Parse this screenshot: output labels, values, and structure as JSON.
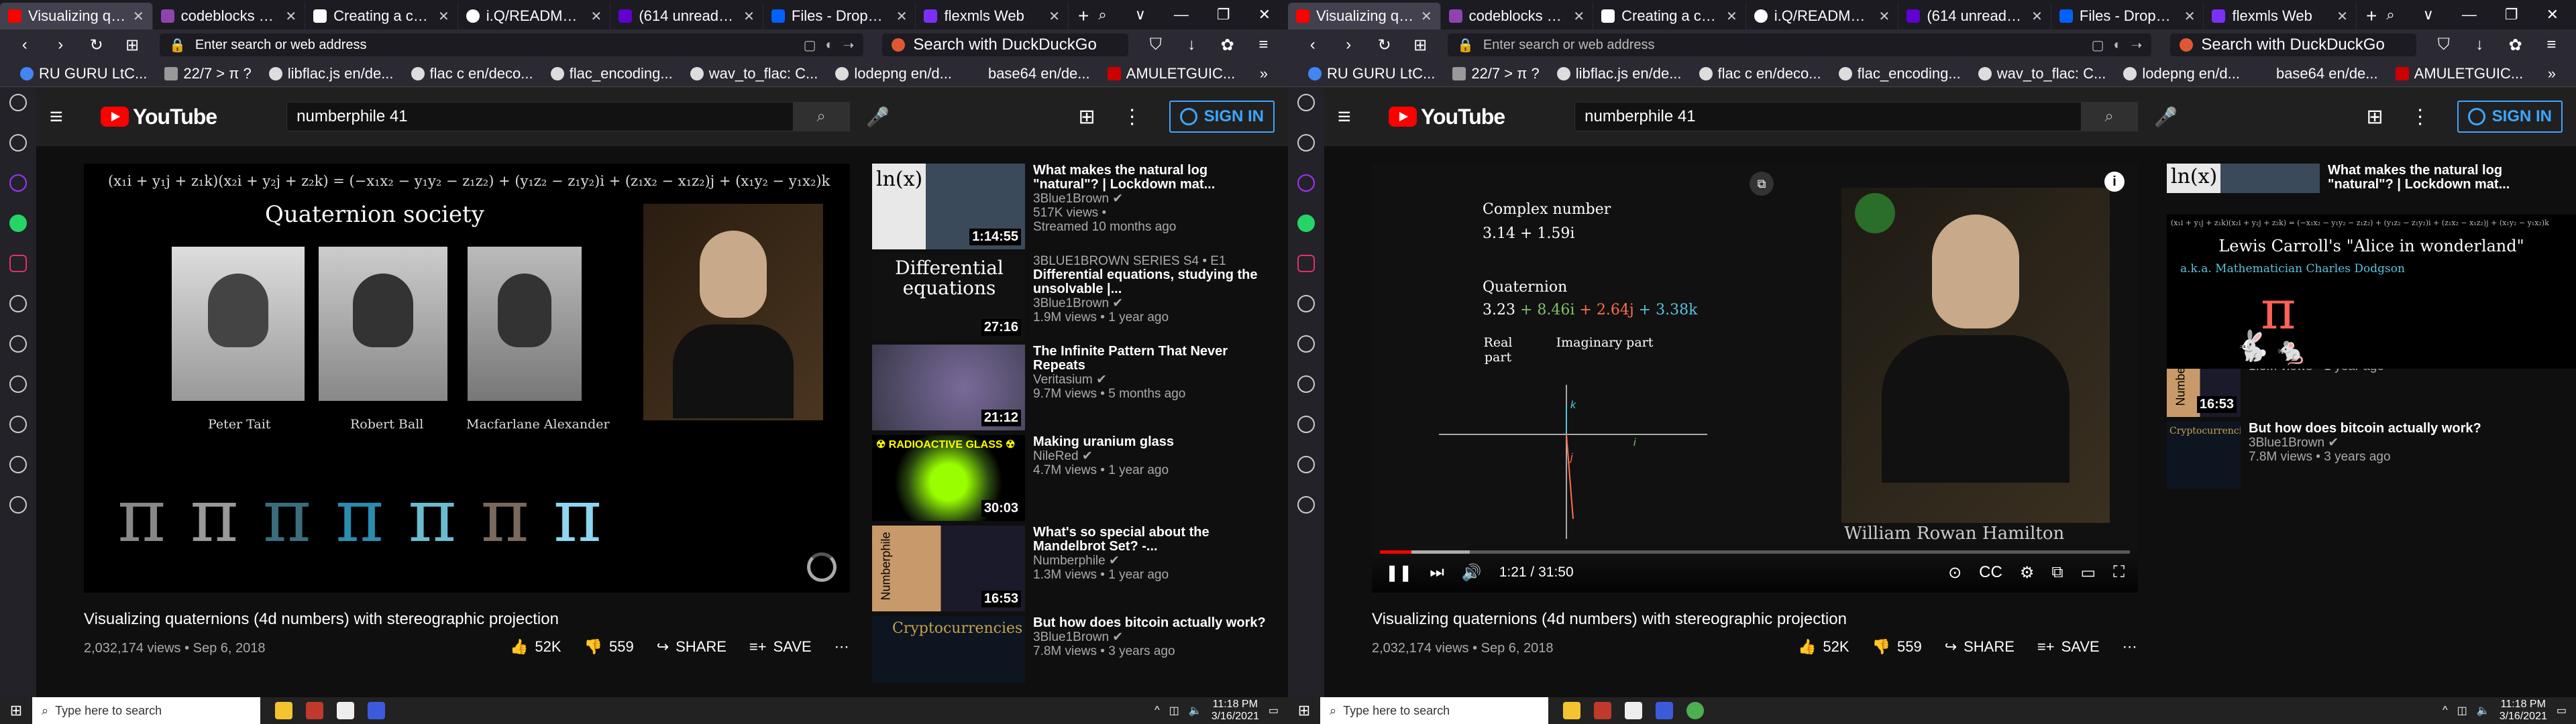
{
  "tabs": [
    {
      "label": "Visualizing quat",
      "fav": "#ff0000",
      "active": true
    },
    {
      "label": "codeblocks squ",
      "fav": "#8e44ad"
    },
    {
      "label": "Creating a custo",
      "fav": "#ffffff"
    },
    {
      "label": "i.Q/README.md",
      "fav": "#ffffff"
    },
    {
      "label": "(614 unread) - jc",
      "fav": "#6001d2"
    },
    {
      "label": "Files - Dropbox",
      "fav": "#0061ff"
    },
    {
      "label": "flexmls Web",
      "fav": "#7b2ff7"
    }
  ],
  "window_controls": [
    "⌕",
    "∨",
    "—",
    "❐",
    "✕"
  ],
  "url_placeholder": "Enter search or web address",
  "ddg_label": "Search with DuckDuckGo",
  "bookmarks": [
    "RU GURU LtC...",
    "22/7 > π ?",
    "libflac.js en/de...",
    "flac c en/deco...",
    "flac_encoding...",
    "wav_to_flac: C...",
    "lodepng en/d...",
    "base64 en/de...",
    "AMULETGUIC..."
  ],
  "yt": {
    "logo": "YouTube",
    "search_value": "numberphile 41",
    "signin": "SIGN IN"
  },
  "video": {
    "title": "Visualizing quaternions (4d numbers) with stereographic projection",
    "meta": "2,032,174 views • Sep 6, 2018",
    "likes": "52K",
    "dislikes": "559",
    "share": "SHARE",
    "save": "SAVE"
  },
  "player1": {
    "formula": "(x₁i + y₁j + z₁k)(x₂i + y₂j + z₂k) = (−x₁x₂ − y₁y₂ − z₁z₂) + (y₁z₂ − z₁y₂)i + (z₁x₂ − x₁z₂)j + (x₁y₂ − y₁x₂)k",
    "heading": "Quaternion society",
    "people": [
      "Peter Tait",
      "Robert Ball",
      "Macfarlane Alexander"
    ],
    "pi": "π"
  },
  "player2": {
    "complex_label": "Complex number",
    "complex_value": "3.14 + 1.59i",
    "quat_label": "Quaternion",
    "quat_value": [
      "3.23",
      "+ 8.46i",
      "+ 2.64j",
      "+ 3.38k"
    ],
    "real_part": "Real part",
    "imag_part": "Imaginary part",
    "portrait_caption": "William Rowan Hamilton",
    "time": "1:21 / 31:50",
    "progress": 0.042,
    "axis_labels": {
      "k": "k",
      "j": "j",
      "i": "i"
    }
  },
  "recs": [
    {
      "title": "What makes the natural log \"natural\"? | Lockdown mat...",
      "channel": "3Blue1Brown ✔",
      "stats": "517K views •",
      "stats2": "Streamed 10 months ago",
      "dur": "1:14:55",
      "thumb_text": "ln(x)"
    },
    {
      "title": "Differential equations, studying the unsolvable |...",
      "channel": "3Blue1Brown ✔",
      "stats": "1.9M views • 1 year ago",
      "pre": "3BLUE1BROWN SERIES  S4 • E1",
      "dur": "27:16",
      "thumb_text": "Differential equations"
    },
    {
      "title": "The Infinite Pattern That Never Repeats",
      "channel": "Veritasium ✔",
      "stats": "9.7M views • 5 months ago",
      "dur": "21:12",
      "thumb_text": ""
    },
    {
      "title": "Making uranium glass",
      "channel": "NileRed ✔",
      "stats": "4.7M views • 1 year ago",
      "dur": "30:03",
      "thumb_text": "☢ RADIOACTIVE GLASS ☢"
    },
    {
      "title": "What's so special about the Mandelbrot Set? -...",
      "channel": "Numberphile ✔",
      "stats": "1.3M views • 1 year ago",
      "dur": "16:53",
      "thumb_text": "Numberphile"
    },
    {
      "title": "But how does bitcoin actually work?",
      "channel": "3Blue1Brown ✔",
      "stats": "7.8M views • 3 years ago",
      "dur": "",
      "thumb_text": "Cryptocurrencies"
    }
  ],
  "rec_overlay2": {
    "heading": "Lewis Carroll's \"Alice in wonderland\"",
    "subheading": "a.k.a. Mathematician Charles Dodgson"
  },
  "taskbar": {
    "search": "Type here to search",
    "time": "11:18 PM",
    "date": "3/16/2021"
  }
}
